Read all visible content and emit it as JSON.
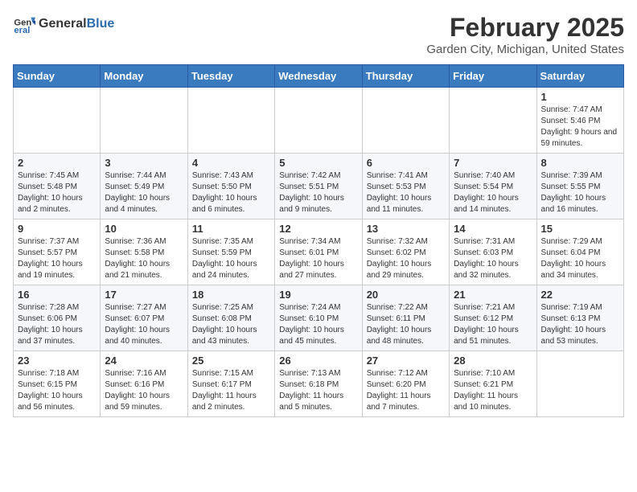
{
  "header": {
    "logo_line1": "General",
    "logo_line2": "Blue",
    "month": "February 2025",
    "location": "Garden City, Michigan, United States"
  },
  "weekdays": [
    "Sunday",
    "Monday",
    "Tuesday",
    "Wednesday",
    "Thursday",
    "Friday",
    "Saturday"
  ],
  "weeks": [
    [
      {
        "day": "",
        "info": ""
      },
      {
        "day": "",
        "info": ""
      },
      {
        "day": "",
        "info": ""
      },
      {
        "day": "",
        "info": ""
      },
      {
        "day": "",
        "info": ""
      },
      {
        "day": "",
        "info": ""
      },
      {
        "day": "1",
        "info": "Sunrise: 7:47 AM\nSunset: 5:46 PM\nDaylight: 9 hours and 59 minutes."
      }
    ],
    [
      {
        "day": "2",
        "info": "Sunrise: 7:45 AM\nSunset: 5:48 PM\nDaylight: 10 hours and 2 minutes."
      },
      {
        "day": "3",
        "info": "Sunrise: 7:44 AM\nSunset: 5:49 PM\nDaylight: 10 hours and 4 minutes."
      },
      {
        "day": "4",
        "info": "Sunrise: 7:43 AM\nSunset: 5:50 PM\nDaylight: 10 hours and 6 minutes."
      },
      {
        "day": "5",
        "info": "Sunrise: 7:42 AM\nSunset: 5:51 PM\nDaylight: 10 hours and 9 minutes."
      },
      {
        "day": "6",
        "info": "Sunrise: 7:41 AM\nSunset: 5:53 PM\nDaylight: 10 hours and 11 minutes."
      },
      {
        "day": "7",
        "info": "Sunrise: 7:40 AM\nSunset: 5:54 PM\nDaylight: 10 hours and 14 minutes."
      },
      {
        "day": "8",
        "info": "Sunrise: 7:39 AM\nSunset: 5:55 PM\nDaylight: 10 hours and 16 minutes."
      }
    ],
    [
      {
        "day": "9",
        "info": "Sunrise: 7:37 AM\nSunset: 5:57 PM\nDaylight: 10 hours and 19 minutes."
      },
      {
        "day": "10",
        "info": "Sunrise: 7:36 AM\nSunset: 5:58 PM\nDaylight: 10 hours and 21 minutes."
      },
      {
        "day": "11",
        "info": "Sunrise: 7:35 AM\nSunset: 5:59 PM\nDaylight: 10 hours and 24 minutes."
      },
      {
        "day": "12",
        "info": "Sunrise: 7:34 AM\nSunset: 6:01 PM\nDaylight: 10 hours and 27 minutes."
      },
      {
        "day": "13",
        "info": "Sunrise: 7:32 AM\nSunset: 6:02 PM\nDaylight: 10 hours and 29 minutes."
      },
      {
        "day": "14",
        "info": "Sunrise: 7:31 AM\nSunset: 6:03 PM\nDaylight: 10 hours and 32 minutes."
      },
      {
        "day": "15",
        "info": "Sunrise: 7:29 AM\nSunset: 6:04 PM\nDaylight: 10 hours and 34 minutes."
      }
    ],
    [
      {
        "day": "16",
        "info": "Sunrise: 7:28 AM\nSunset: 6:06 PM\nDaylight: 10 hours and 37 minutes."
      },
      {
        "day": "17",
        "info": "Sunrise: 7:27 AM\nSunset: 6:07 PM\nDaylight: 10 hours and 40 minutes."
      },
      {
        "day": "18",
        "info": "Sunrise: 7:25 AM\nSunset: 6:08 PM\nDaylight: 10 hours and 43 minutes."
      },
      {
        "day": "19",
        "info": "Sunrise: 7:24 AM\nSunset: 6:10 PM\nDaylight: 10 hours and 45 minutes."
      },
      {
        "day": "20",
        "info": "Sunrise: 7:22 AM\nSunset: 6:11 PM\nDaylight: 10 hours and 48 minutes."
      },
      {
        "day": "21",
        "info": "Sunrise: 7:21 AM\nSunset: 6:12 PM\nDaylight: 10 hours and 51 minutes."
      },
      {
        "day": "22",
        "info": "Sunrise: 7:19 AM\nSunset: 6:13 PM\nDaylight: 10 hours and 53 minutes."
      }
    ],
    [
      {
        "day": "23",
        "info": "Sunrise: 7:18 AM\nSunset: 6:15 PM\nDaylight: 10 hours and 56 minutes."
      },
      {
        "day": "24",
        "info": "Sunrise: 7:16 AM\nSunset: 6:16 PM\nDaylight: 10 hours and 59 minutes."
      },
      {
        "day": "25",
        "info": "Sunrise: 7:15 AM\nSunset: 6:17 PM\nDaylight: 11 hours and 2 minutes."
      },
      {
        "day": "26",
        "info": "Sunrise: 7:13 AM\nSunset: 6:18 PM\nDaylight: 11 hours and 5 minutes."
      },
      {
        "day": "27",
        "info": "Sunrise: 7:12 AM\nSunset: 6:20 PM\nDaylight: 11 hours and 7 minutes."
      },
      {
        "day": "28",
        "info": "Sunrise: 7:10 AM\nSunset: 6:21 PM\nDaylight: 11 hours and 10 minutes."
      },
      {
        "day": "",
        "info": ""
      }
    ]
  ]
}
